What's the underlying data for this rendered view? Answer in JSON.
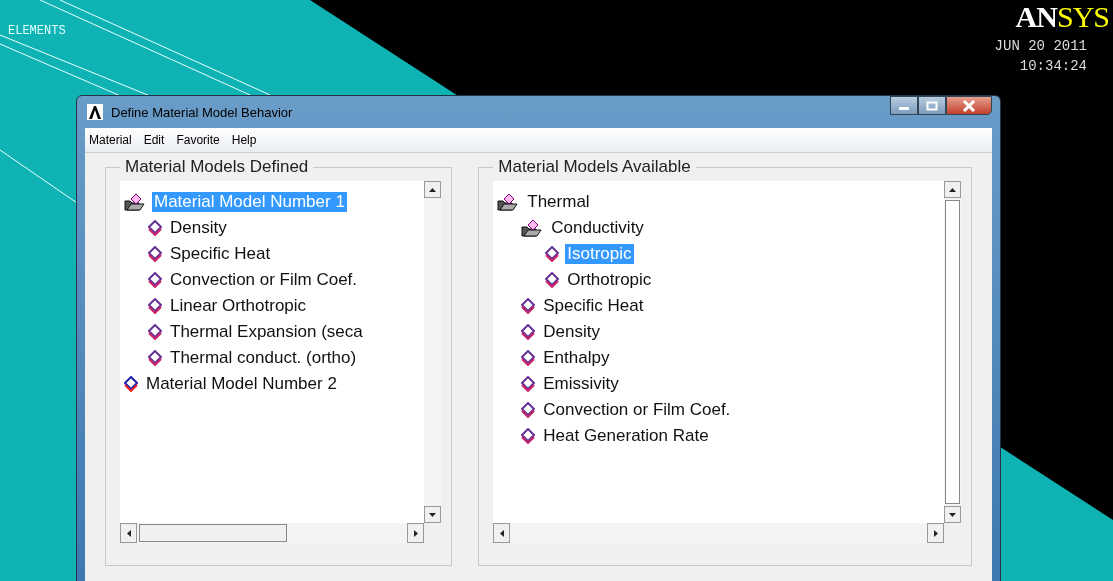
{
  "desktop": {
    "label": "ELEMENTS",
    "logo": [
      "AN",
      "SYS"
    ],
    "date": "JUN 20 2011",
    "time": "10:34:24"
  },
  "window": {
    "title": "Define Material Model Behavior",
    "menu": [
      "Material",
      "Edit",
      "Favorite",
      "Help"
    ],
    "panels": [
      {
        "title": "Material Models Defined",
        "tree": [
          {
            "label": "Material Model Number 1",
            "selected": true,
            "expanded": true,
            "children": [
              {
                "label": "Density",
                "selected": false
              },
              {
                "label": "Specific Heat",
                "selected": false
              },
              {
                "label": "Convection or Film Coef.",
                "selected": false
              },
              {
                "label": "Linear Orthotropic",
                "selected": false
              },
              {
                "label": "Thermal Expansion (seca",
                "selected": false
              },
              {
                "label": "Thermal conduct. (ortho)",
                "selected": false
              }
            ]
          },
          {
            "label": "Material Model Number 2",
            "selected": false,
            "expanded": false
          }
        ]
      },
      {
        "title": "Material Models Available",
        "tree": [
          {
            "label": "Thermal",
            "selected": false,
            "expanded": true,
            "children": [
              {
                "label": "Conductivity",
                "selected": false,
                "expanded": true,
                "children": [
                  {
                    "label": "Isotropic",
                    "selected": true
                  },
                  {
                    "label": "Orthotropic",
                    "selected": false
                  }
                ]
              },
              {
                "label": "Specific Heat",
                "selected": false
              },
              {
                "label": "Density",
                "selected": false
              },
              {
                "label": "Enthalpy",
                "selected": false
              },
              {
                "label": "Emissivity",
                "selected": false
              },
              {
                "label": "Convection or Film Coef.",
                "selected": false
              },
              {
                "label": "Heat Generation Rate",
                "selected": false
              }
            ]
          }
        ]
      }
    ]
  }
}
